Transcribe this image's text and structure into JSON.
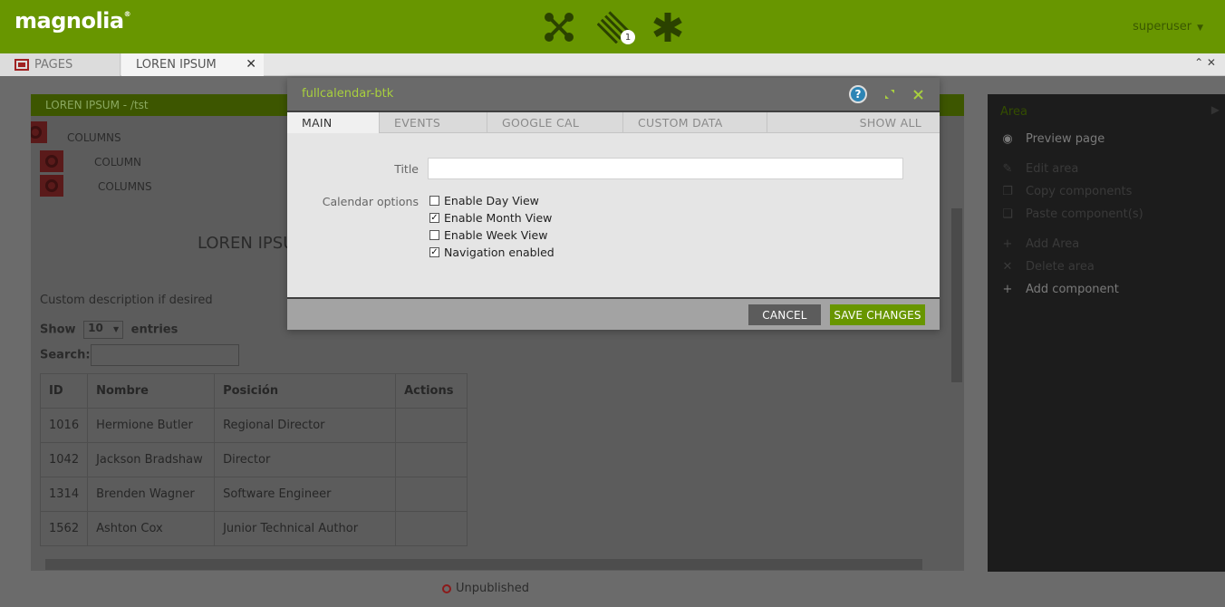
{
  "app": {
    "logo_text": "magnolia",
    "logo_mark": "®",
    "user": "superuser",
    "notification_count": "1"
  },
  "tabs": {
    "pages_label": "PAGES",
    "lorem_label": "LOREN IPSUM",
    "close_glyph": "✕",
    "window_controls": "⌃ ✕"
  },
  "page": {
    "header": "LOREN IPSUM - /tst",
    "rows": [
      "COLUMNS",
      "COLUMN",
      "COLUMNS"
    ],
    "title": "LOREN IPSUM",
    "description": "Custom description if desired",
    "show_label": "Show",
    "show_value": "10",
    "entries_label": "entries",
    "search_label": "Search:",
    "table": {
      "headers": [
        "ID",
        "Nombre",
        "Posición",
        "Actions"
      ],
      "rows": [
        [
          "1016",
          "Hermione Butler",
          "Regional Director",
          ""
        ],
        [
          "1042",
          "Jackson Bradshaw",
          "Director",
          ""
        ],
        [
          "1314",
          "Brenden Wagner",
          "Software Engineer",
          ""
        ],
        [
          "1562",
          "Ashton Cox",
          "Junior Technical Author",
          ""
        ]
      ]
    },
    "status": "Unpublished"
  },
  "panel": {
    "title": "Area",
    "items": [
      {
        "label": "Preview page",
        "icon": "eye-icon",
        "glyph": "◉",
        "color": "#7a7a7a"
      },
      {
        "label": "Edit area",
        "icon": "pencil-icon",
        "glyph": "✎",
        "color": "#3a3a3a"
      },
      {
        "label": "Copy components",
        "icon": "copy-icon",
        "glyph": "❐",
        "color": "#3a3a3a"
      },
      {
        "label": "Paste component(s)",
        "icon": "paste-icon",
        "glyph": "❏",
        "color": "#3a3a3a"
      },
      {
        "label": "Add Area",
        "icon": "plus-icon",
        "glyph": "+",
        "color": "#3a3a3a"
      },
      {
        "label": "Delete area",
        "icon": "delete-icon",
        "glyph": "✕",
        "color": "#3a3a3a"
      },
      {
        "label": "Add component",
        "icon": "plus-icon",
        "glyph": "+",
        "color": "#7a7a7a"
      }
    ]
  },
  "dialog": {
    "title": "fullcalendar-btk",
    "help_glyph": "?",
    "tabs": [
      "MAIN",
      "EVENTS",
      "GOOGLE CAL",
      "CUSTOM DATA",
      "SHOW ALL"
    ],
    "title_label": "Title",
    "title_value": "",
    "options_label": "Calendar options",
    "options": [
      {
        "label": "Enable Day View",
        "checked": false
      },
      {
        "label": "Enable Month View",
        "checked": true
      },
      {
        "label": "Enable Week View",
        "checked": false
      },
      {
        "label": "Navigation enabled",
        "checked": true
      }
    ],
    "cancel_label": "CANCEL",
    "save_label": "SAVE CHANGES"
  },
  "colors": {
    "brand_green": "#689600",
    "title_green": "#a8cf3e"
  }
}
